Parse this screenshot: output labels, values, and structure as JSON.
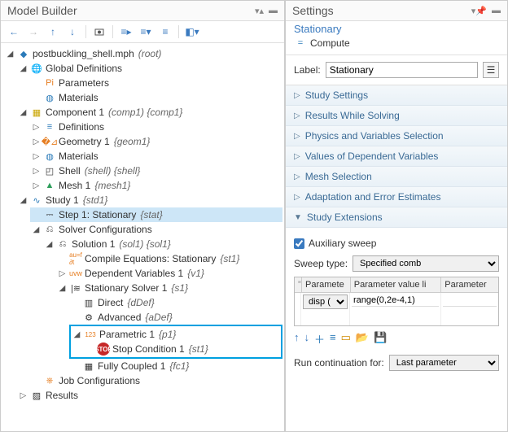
{
  "modelBuilder": {
    "title": "Model Builder",
    "root": {
      "label": "postbuckling_shell.mph",
      "suffix": "(root)"
    },
    "globalDefs": {
      "label": "Global Definitions",
      "params": "Parameters",
      "materials": "Materials"
    },
    "component": {
      "label": "Component 1",
      "suffix": "(comp1) {comp1}",
      "defs": "Definitions",
      "geom": {
        "label": "Geometry 1",
        "suffix": "{geom1}"
      },
      "materials": "Materials",
      "shell": {
        "label": "Shell",
        "suffix": "(shell) {shell}"
      },
      "mesh": {
        "label": "Mesh 1",
        "suffix": "{mesh1}"
      }
    },
    "study": {
      "label": "Study 1",
      "suffix": "{std1}",
      "step1": {
        "label": "Step 1: Stationary",
        "suffix": "{stat}"
      },
      "solverConfigs": "Solver Configurations",
      "solution": {
        "label": "Solution 1",
        "suffix": "(sol1) {sol1}"
      },
      "compile": {
        "label": "Compile Equations: Stationary",
        "suffix": "{st1}"
      },
      "depvars": {
        "label": "Dependent Variables 1",
        "suffix": "{v1}"
      },
      "statSolver": {
        "label": "Stationary Solver 1",
        "suffix": "{s1}"
      },
      "direct": {
        "label": "Direct",
        "suffix": "{dDef}"
      },
      "advanced": {
        "label": "Advanced",
        "suffix": "{aDef}"
      },
      "parametric": {
        "label": "Parametric 1",
        "suffix": "{p1}"
      },
      "stopCond": {
        "label": "Stop Condition 1",
        "suffix": "{st1}"
      },
      "fullyCoupled": {
        "label": "Fully Coupled 1",
        "suffix": "{fc1}"
      },
      "jobConfigs": "Job Configurations"
    },
    "results": "Results"
  },
  "settings": {
    "title": "Settings",
    "subtitle": "Stationary",
    "compute": "Compute",
    "labelLabel": "Label:",
    "labelValue": "Stationary",
    "sections": {
      "studySettings": "Study Settings",
      "resultsWhile": "Results While Solving",
      "physicsVars": "Physics and Variables Selection",
      "depVars": "Values of Dependent Variables",
      "meshSel": "Mesh Selection",
      "adaptation": "Adaptation and Error Estimates",
      "studyExt": "Study Extensions"
    },
    "ext": {
      "auxSweep": "Auxiliary sweep",
      "sweepType": "Sweep type:",
      "sweepValue": "Specified comb",
      "cols": {
        "p": "Paramete",
        "v": "Parameter value li",
        "u": "Parameter"
      },
      "row": {
        "param": "disp (",
        "vals": "range(0,2e-4,1)",
        "unit": ""
      },
      "runCont": "Run continuation for:",
      "runContVal": "Last parameter"
    }
  }
}
